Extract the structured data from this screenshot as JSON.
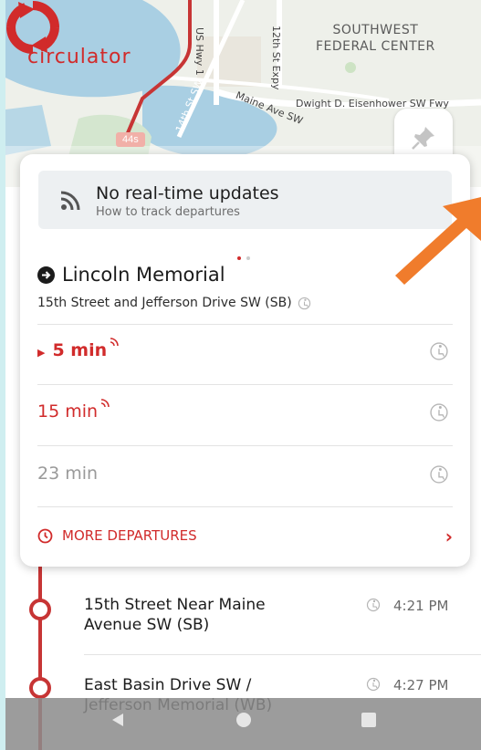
{
  "app": {
    "logo_text": "circulator"
  },
  "map": {
    "labels": {
      "southwest_line1": "SOUTHWEST",
      "southwest_line2": "FEDERAL CENTER",
      "freeway": "Dwight D. Eisenhower SW Fwy",
      "maine_ave": "Maine Ave SW",
      "us_hwy": "US Hwy 1",
      "twelfth_st": "12th St Expy",
      "fourteenth_st": "14th St SW"
    },
    "vehicle_badge": "44s"
  },
  "realtime_banner": {
    "title": "No real-time updates",
    "subtitle": "How to track departures"
  },
  "stop": {
    "name": "Lincoln Memorial",
    "subtitle": "15th Street and Jefferson Drive SW (SB)"
  },
  "departures": [
    {
      "time": "5 min",
      "style": "red-bold",
      "realtime": true
    },
    {
      "time": "15 min",
      "style": "red",
      "realtime": true
    },
    {
      "time": "23 min",
      "style": "gray",
      "realtime": false
    }
  ],
  "more_departures_label": "MORE DEPARTURES",
  "timeline": [
    {
      "stop": "15th Street Near Maine Avenue SW (SB)",
      "time": "4:21 PM"
    },
    {
      "stop": "East Basin Drive SW / Jefferson Memorial (WB)",
      "time": "4:27 PM"
    }
  ],
  "colors": {
    "accent": "#d12b2b",
    "route_line": "#c73535",
    "arrow": "#f07c2c"
  }
}
